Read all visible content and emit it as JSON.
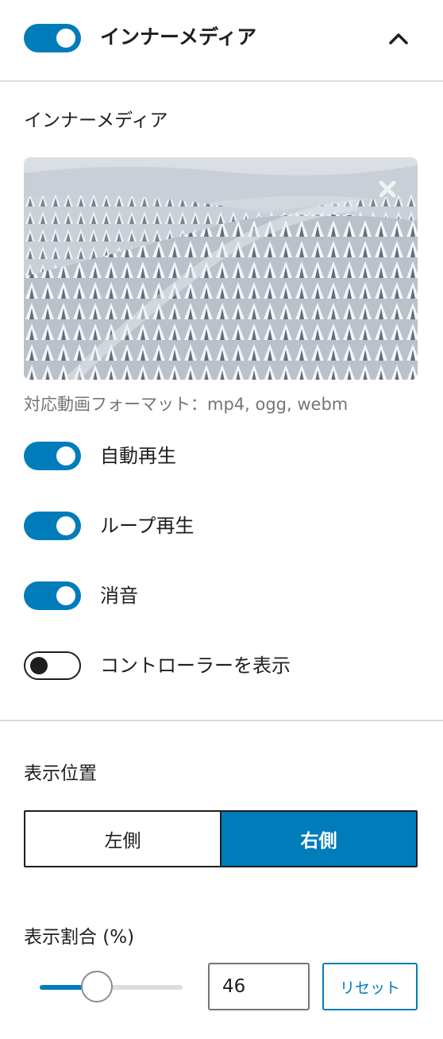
{
  "header": {
    "title": "インナーメディア",
    "enabled": true,
    "collapse_icon": "chevron-up-icon"
  },
  "media": {
    "label": "インナーメディア",
    "preview_alt": "snowy forest aerial view",
    "remove_icon": "close-icon",
    "help_text": "対応動画フォーマット：mp4, ogg, webm"
  },
  "toggles": [
    {
      "label": "自動再生",
      "checked": true
    },
    {
      "label": "ループ再生",
      "checked": true
    },
    {
      "label": "消音",
      "checked": true
    },
    {
      "label": "コントローラーを表示",
      "checked": false
    }
  ],
  "position": {
    "label": "表示位置",
    "options": [
      "左側",
      "右側"
    ],
    "selected": "右側"
  },
  "ratio": {
    "label": "表示割合 (%)",
    "value": "46",
    "slider_percent": 40,
    "reset_label": "リセット"
  },
  "colors": {
    "accent": "#007cba",
    "text": "#1e1e1e",
    "help": "#757575",
    "divider": "#dcdcde"
  }
}
